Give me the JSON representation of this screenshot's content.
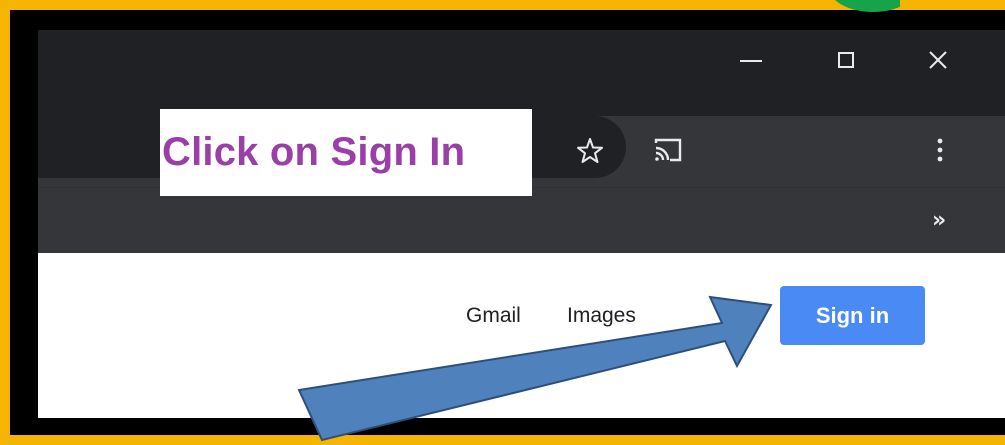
{
  "instruction": {
    "text": "Click on Sign In"
  },
  "window_controls": {
    "minimize": "minimize-icon",
    "maximize": "maximize-icon",
    "close": "close-icon"
  },
  "toolbar": {
    "bookmark_icon": "star-icon",
    "cast_icon": "cast-icon",
    "menu_icon": "kebab-menu-icon",
    "bookmarks_more": "»"
  },
  "page": {
    "links": {
      "gmail": "Gmail",
      "images": "Images"
    },
    "sign_in_label": "Sign in"
  },
  "colors": {
    "frame_border": "#f5b400",
    "instruction_text": "#9b3fa8",
    "sign_in_button": "#4a8af4",
    "arrow_fill": "#4f81bd",
    "chrome_dark": "#202124",
    "toolbar": "#35363a"
  }
}
